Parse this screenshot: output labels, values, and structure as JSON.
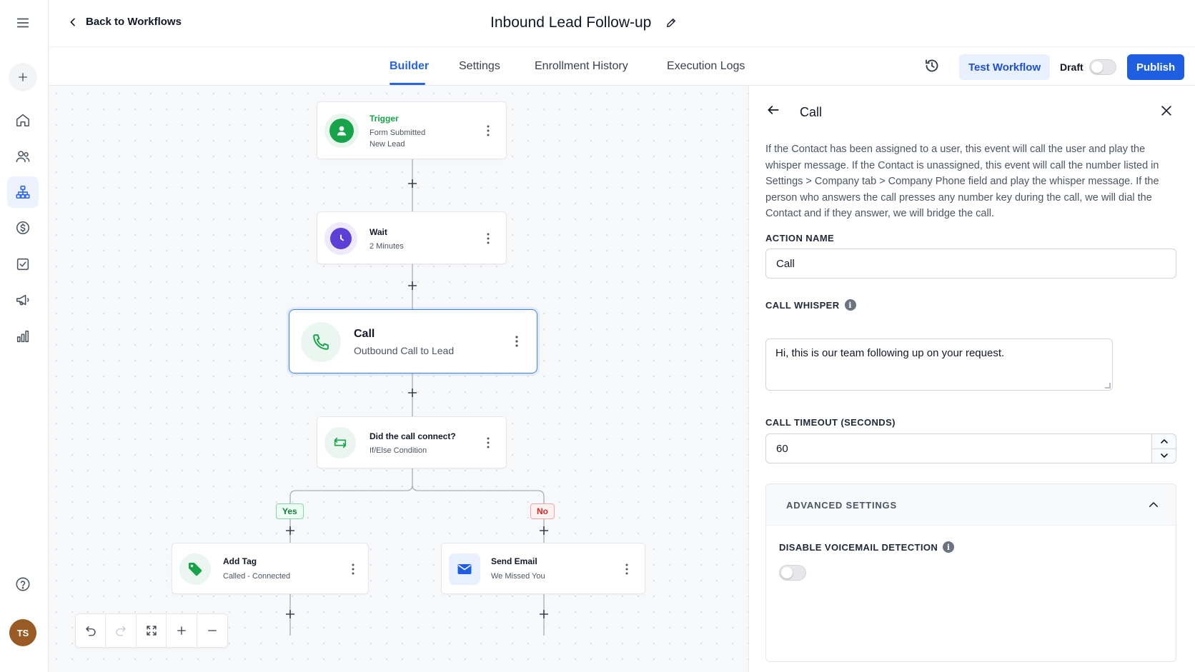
{
  "header": {
    "back_label": "Back to Workflows",
    "title": "Inbound Lead Follow-up"
  },
  "tabs": [
    {
      "label": "Builder",
      "active": true
    },
    {
      "label": "Settings",
      "active": false
    },
    {
      "label": "Enrollment History",
      "active": false
    },
    {
      "label": "Execution Logs",
      "active": false
    }
  ],
  "actions": {
    "test_label": "Test Workflow",
    "draft_label": "Draft",
    "draft_enabled": false,
    "publish_label": "Publish"
  },
  "sidebar": {
    "items": [
      {
        "icon": "home-icon",
        "active": false
      },
      {
        "icon": "contacts-icon",
        "active": false
      },
      {
        "icon": "workflow-icon",
        "active": true
      },
      {
        "icon": "dollar-icon",
        "active": false
      },
      {
        "icon": "checkbox-icon",
        "active": false
      },
      {
        "icon": "megaphone-icon",
        "active": false
      },
      {
        "icon": "bar-chart-icon",
        "active": false
      }
    ],
    "avatar_initials": "TS"
  },
  "nodes": {
    "trigger": {
      "title": "Trigger",
      "line1": "Form Submitted",
      "line2": "New Lead"
    },
    "wait": {
      "title": "Wait",
      "subtitle": "2 Minutes"
    },
    "call": {
      "title": "Call",
      "subtitle": "Outbound Call to Lead"
    },
    "condition": {
      "title": "Did the call connect?",
      "subtitle": "If/Else Condition"
    },
    "branch_yes": "Yes",
    "branch_no": "No",
    "add_tag": {
      "title": "Add Tag",
      "subtitle": "Called - Connected"
    },
    "send_email": {
      "title": "Send Email",
      "subtitle": "We Missed You"
    }
  },
  "panel": {
    "title": "Call",
    "description": "If the Contact has been assigned to a user, this event will call the user and play the whisper message. If the Contact is unassigned, this event will call the number listed in Settings > Company tab > Company Phone field and play the whisper message. If the person who answers the call presses any number key during the call, we will dial the Contact and if they answer, we will bridge the call.",
    "action_name_label": "ACTION NAME",
    "action_name_value": "Call",
    "call_whisper_label": "CALL WHISPER",
    "call_whisper_value": "Hi, this is our team following up on your request.",
    "timeout_label": "CALL TIMEOUT (SECONDS)",
    "timeout_value": "60",
    "advanced_label": "ADVANCED SETTINGS",
    "voicemail_label": "DISABLE VOICEMAIL DETECTION",
    "voicemail_enabled": false
  },
  "colors": {
    "accent": "#2563eb",
    "trigger_green": "#16a34a",
    "wait_purple": "#5b3fd6",
    "yes_green": "#15803d",
    "no_red": "#dc2626"
  }
}
